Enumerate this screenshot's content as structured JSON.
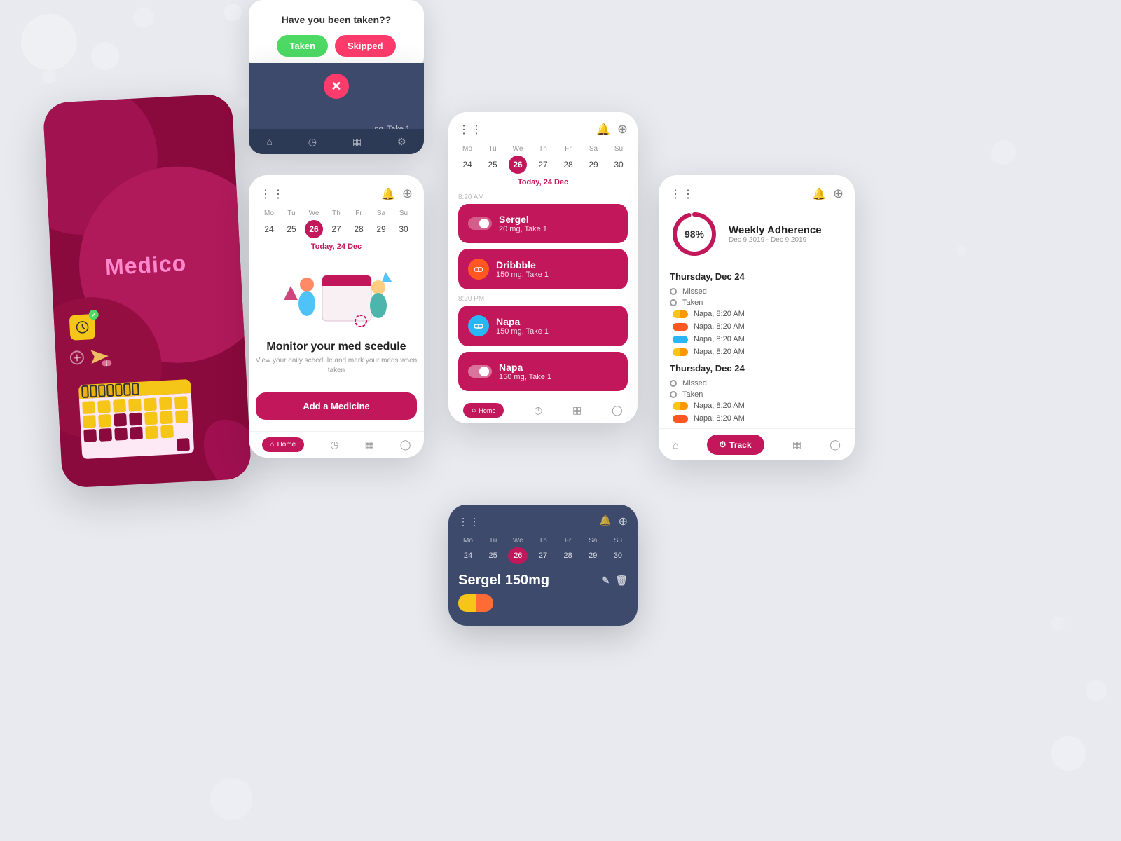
{
  "app": {
    "name": "Medico",
    "bg_color": "#e8eaf0"
  },
  "popup": {
    "question": "Have you been taken??",
    "taken_label": "Taken",
    "skipped_label": "Skipped"
  },
  "screen_main": {
    "today_label": "Today, 24 Dec",
    "calendar": {
      "days": [
        "Mo",
        "Tu",
        "We",
        "Th",
        "Fr",
        "Sa",
        "Su"
      ],
      "dates": [
        "24",
        "25",
        "26",
        "27",
        "28",
        "29",
        "30"
      ],
      "active_index": 2
    },
    "illustration_title": "Monitor your med scedule",
    "illustration_sub": "View your daily schedule and mark\nyour meds when taken",
    "add_btn": "Add a Medicine",
    "nav": {
      "home": "Home",
      "chart": "Chart",
      "calendar": "Calendar",
      "profile": "Profile"
    }
  },
  "screen_schedule": {
    "today_label": "Today, 24 Dec",
    "calendar": {
      "days": [
        "Mo",
        "Tu",
        "We",
        "Th",
        "Fr",
        "Sa",
        "Su"
      ],
      "dates": [
        "24",
        "25",
        "26",
        "27",
        "28",
        "29",
        "30"
      ],
      "active_index": 2
    },
    "times": {
      "morning": "8:20 AM",
      "evening": "8:20 PM"
    },
    "medications": [
      {
        "name": "Sergel",
        "dose": "20 mg, Take 1",
        "color": "#f5c518",
        "slot": "morning"
      },
      {
        "name": "Dribbble",
        "dose": "150 mg, Take 1",
        "color": "#ff5722",
        "slot": "morning"
      },
      {
        "name": "Napa",
        "dose": "150 mg, Take 1",
        "color": "#29b6f6",
        "slot": "evening"
      },
      {
        "name": "Napa",
        "dose": "150 mg, Take 1",
        "color": "#f5c518",
        "slot": "evening"
      }
    ]
  },
  "screen_detail": {
    "calendar": {
      "days": [
        "Mo",
        "Tu",
        "We",
        "Th",
        "Fr",
        "Sa",
        "Su"
      ],
      "dates": [
        "24",
        "25",
        "26",
        "27",
        "28",
        "29",
        "30"
      ],
      "active_index": 2
    },
    "med_name": "Sergel 150mg"
  },
  "screen_adherence": {
    "percentage": "98%",
    "title": "Weekly Adherence",
    "date_range": "Dec 9 2019 - Dec 9 2019",
    "sections": [
      {
        "title": "Thursday, Dec 24",
        "statuses": [
          {
            "label": "Missed",
            "type": "missed"
          },
          {
            "label": "Taken",
            "type": "taken"
          }
        ],
        "logs": [
          {
            "text": "Napa, 8:20 AM",
            "pill": "yellow"
          },
          {
            "text": "Napa, 8:20 AM",
            "pill": "orange"
          },
          {
            "text": "Napa, 8:20 AM",
            "pill": "blue"
          },
          {
            "text": "Napa, 8:20 AM",
            "pill": "yellow"
          }
        ]
      },
      {
        "title": "Thursday, Dec 24",
        "statuses": [
          {
            "label": "Missed",
            "type": "missed"
          },
          {
            "label": "Taken",
            "type": "taken"
          }
        ],
        "logs": [
          {
            "text": "Napa, 8:20 AM",
            "pill": "yellow"
          },
          {
            "text": "Napa, 8:20 AM",
            "pill": "orange"
          }
        ]
      }
    ],
    "track_btn": "Track",
    "nav": {
      "home": "Home",
      "track": "Track",
      "calendar": "Calendar",
      "profile": "Profile"
    }
  }
}
